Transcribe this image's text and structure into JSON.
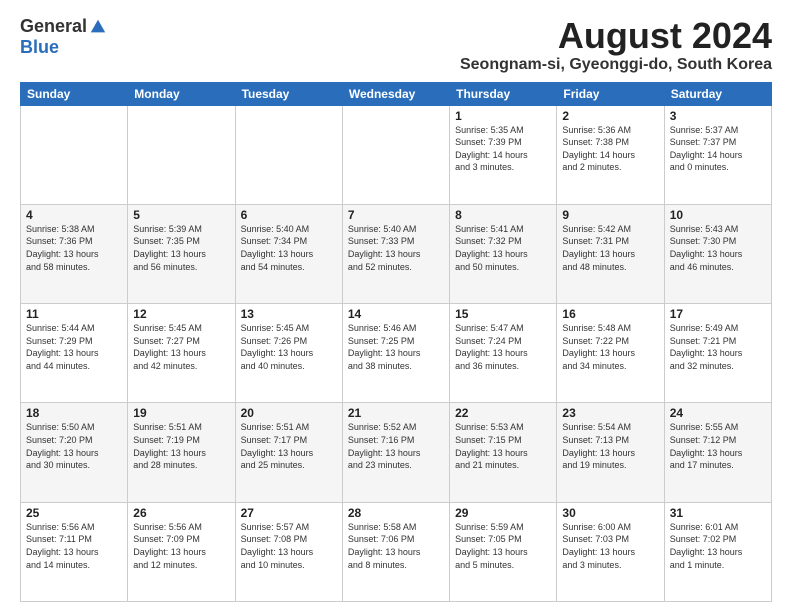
{
  "logo": {
    "general": "General",
    "blue": "Blue"
  },
  "title": "August 2024",
  "subtitle": "Seongnam-si, Gyeonggi-do, South Korea",
  "weekdays": [
    "Sunday",
    "Monday",
    "Tuesday",
    "Wednesday",
    "Thursday",
    "Friday",
    "Saturday"
  ],
  "weeks": [
    [
      {
        "day": "",
        "info": ""
      },
      {
        "day": "",
        "info": ""
      },
      {
        "day": "",
        "info": ""
      },
      {
        "day": "",
        "info": ""
      },
      {
        "day": "1",
        "info": "Sunrise: 5:35 AM\nSunset: 7:39 PM\nDaylight: 14 hours\nand 3 minutes."
      },
      {
        "day": "2",
        "info": "Sunrise: 5:36 AM\nSunset: 7:38 PM\nDaylight: 14 hours\nand 2 minutes."
      },
      {
        "day": "3",
        "info": "Sunrise: 5:37 AM\nSunset: 7:37 PM\nDaylight: 14 hours\nand 0 minutes."
      }
    ],
    [
      {
        "day": "4",
        "info": "Sunrise: 5:38 AM\nSunset: 7:36 PM\nDaylight: 13 hours\nand 58 minutes."
      },
      {
        "day": "5",
        "info": "Sunrise: 5:39 AM\nSunset: 7:35 PM\nDaylight: 13 hours\nand 56 minutes."
      },
      {
        "day": "6",
        "info": "Sunrise: 5:40 AM\nSunset: 7:34 PM\nDaylight: 13 hours\nand 54 minutes."
      },
      {
        "day": "7",
        "info": "Sunrise: 5:40 AM\nSunset: 7:33 PM\nDaylight: 13 hours\nand 52 minutes."
      },
      {
        "day": "8",
        "info": "Sunrise: 5:41 AM\nSunset: 7:32 PM\nDaylight: 13 hours\nand 50 minutes."
      },
      {
        "day": "9",
        "info": "Sunrise: 5:42 AM\nSunset: 7:31 PM\nDaylight: 13 hours\nand 48 minutes."
      },
      {
        "day": "10",
        "info": "Sunrise: 5:43 AM\nSunset: 7:30 PM\nDaylight: 13 hours\nand 46 minutes."
      }
    ],
    [
      {
        "day": "11",
        "info": "Sunrise: 5:44 AM\nSunset: 7:29 PM\nDaylight: 13 hours\nand 44 minutes."
      },
      {
        "day": "12",
        "info": "Sunrise: 5:45 AM\nSunset: 7:27 PM\nDaylight: 13 hours\nand 42 minutes."
      },
      {
        "day": "13",
        "info": "Sunrise: 5:45 AM\nSunset: 7:26 PM\nDaylight: 13 hours\nand 40 minutes."
      },
      {
        "day": "14",
        "info": "Sunrise: 5:46 AM\nSunset: 7:25 PM\nDaylight: 13 hours\nand 38 minutes."
      },
      {
        "day": "15",
        "info": "Sunrise: 5:47 AM\nSunset: 7:24 PM\nDaylight: 13 hours\nand 36 minutes."
      },
      {
        "day": "16",
        "info": "Sunrise: 5:48 AM\nSunset: 7:22 PM\nDaylight: 13 hours\nand 34 minutes."
      },
      {
        "day": "17",
        "info": "Sunrise: 5:49 AM\nSunset: 7:21 PM\nDaylight: 13 hours\nand 32 minutes."
      }
    ],
    [
      {
        "day": "18",
        "info": "Sunrise: 5:50 AM\nSunset: 7:20 PM\nDaylight: 13 hours\nand 30 minutes."
      },
      {
        "day": "19",
        "info": "Sunrise: 5:51 AM\nSunset: 7:19 PM\nDaylight: 13 hours\nand 28 minutes."
      },
      {
        "day": "20",
        "info": "Sunrise: 5:51 AM\nSunset: 7:17 PM\nDaylight: 13 hours\nand 25 minutes."
      },
      {
        "day": "21",
        "info": "Sunrise: 5:52 AM\nSunset: 7:16 PM\nDaylight: 13 hours\nand 23 minutes."
      },
      {
        "day": "22",
        "info": "Sunrise: 5:53 AM\nSunset: 7:15 PM\nDaylight: 13 hours\nand 21 minutes."
      },
      {
        "day": "23",
        "info": "Sunrise: 5:54 AM\nSunset: 7:13 PM\nDaylight: 13 hours\nand 19 minutes."
      },
      {
        "day": "24",
        "info": "Sunrise: 5:55 AM\nSunset: 7:12 PM\nDaylight: 13 hours\nand 17 minutes."
      }
    ],
    [
      {
        "day": "25",
        "info": "Sunrise: 5:56 AM\nSunset: 7:11 PM\nDaylight: 13 hours\nand 14 minutes."
      },
      {
        "day": "26",
        "info": "Sunrise: 5:56 AM\nSunset: 7:09 PM\nDaylight: 13 hours\nand 12 minutes."
      },
      {
        "day": "27",
        "info": "Sunrise: 5:57 AM\nSunset: 7:08 PM\nDaylight: 13 hours\nand 10 minutes."
      },
      {
        "day": "28",
        "info": "Sunrise: 5:58 AM\nSunset: 7:06 PM\nDaylight: 13 hours\nand 8 minutes."
      },
      {
        "day": "29",
        "info": "Sunrise: 5:59 AM\nSunset: 7:05 PM\nDaylight: 13 hours\nand 5 minutes."
      },
      {
        "day": "30",
        "info": "Sunrise: 6:00 AM\nSunset: 7:03 PM\nDaylight: 13 hours\nand 3 minutes."
      },
      {
        "day": "31",
        "info": "Sunrise: 6:01 AM\nSunset: 7:02 PM\nDaylight: 13 hours\nand 1 minute."
      }
    ]
  ]
}
